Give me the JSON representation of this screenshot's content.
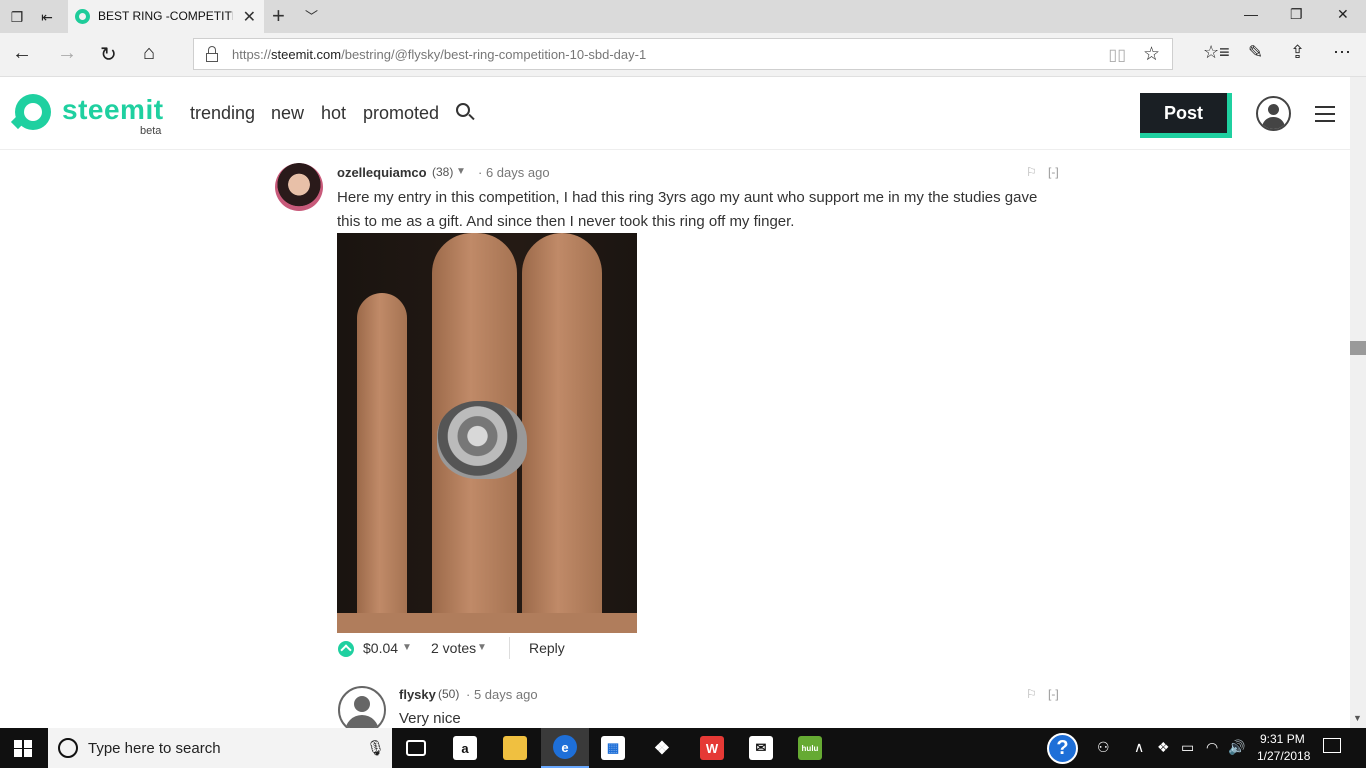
{
  "browser": {
    "tab_title": "BEST RING -COMPETITI",
    "url_prefix": "https://",
    "url_domain": "steemit.com",
    "url_path": "/bestring/@flysky/best-ring-competition-10-sbd-day-1"
  },
  "site": {
    "logo": "steemit",
    "beta": "beta",
    "nav": [
      "trending",
      "new",
      "hot",
      "promoted"
    ],
    "post_label": "Post",
    "accent_color": "#1fd0a0"
  },
  "comments": [
    {
      "author": "ozellequiamco",
      "reputation": "(38)",
      "time": "6 days ago",
      "collapse": "[-]",
      "body": "Here my entry in this competition, I had this ring 3yrs ago my aunt who support me in my the studies gave this to me as a gift. And since then I never took this ring off my finger.",
      "payout": "$0.04",
      "votes": "2 votes",
      "reply": "Reply"
    },
    {
      "author": "flysky",
      "reputation": "(50)",
      "time": "5 days ago",
      "collapse": "[-]",
      "body": "Very nice"
    }
  ],
  "taskbar": {
    "search_placeholder": "Type here to search",
    "apps": [
      "task-view",
      "amazon",
      "file-explorer",
      "edge",
      "store",
      "dropbox",
      "wps",
      "mail",
      "hulu"
    ],
    "hulu_label": "hulu",
    "time": "9:31 PM",
    "date": "1/27/2018"
  }
}
